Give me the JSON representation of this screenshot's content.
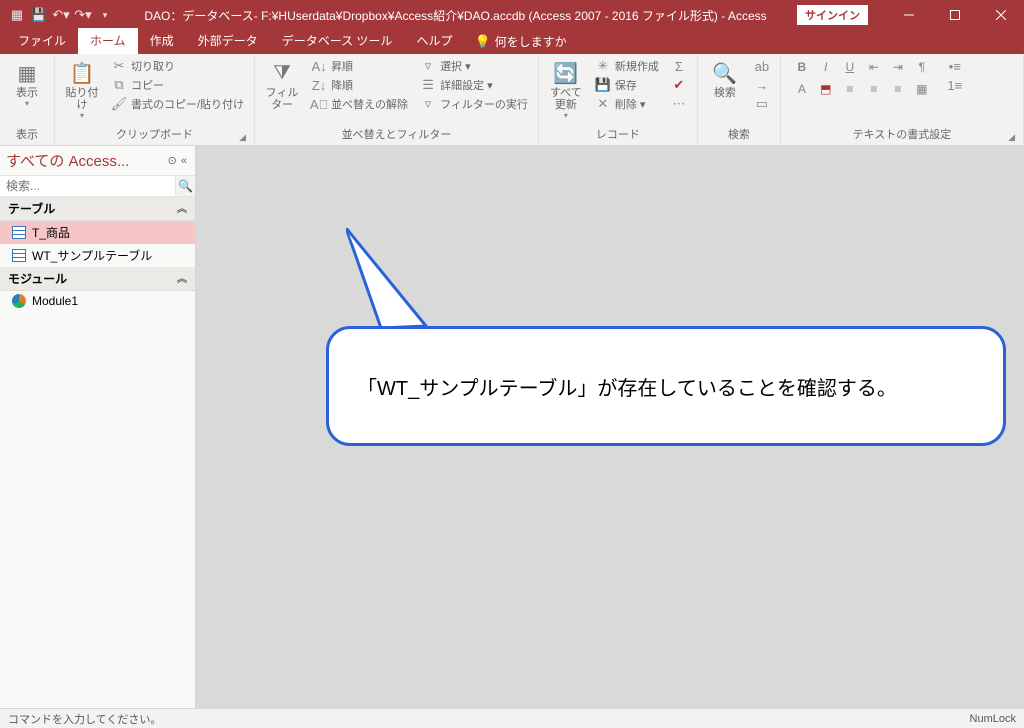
{
  "titlebar": {
    "title": "DAO：データベース- F:¥HUserdata¥Dropbox¥Access紹介¥DAO.accdb (Access 2007 - 2016 ファイル形式)  -  Access",
    "signin": "サインイン"
  },
  "tabs": {
    "file": "ファイル",
    "home": "ホーム",
    "create": "作成",
    "external": "外部データ",
    "dbtools": "データベース ツール",
    "help": "ヘルプ",
    "tell": "何をしますか"
  },
  "ribbon": {
    "view": {
      "label": "表示",
      "group": "表示"
    },
    "clipboard": {
      "paste": "貼り付け",
      "cut": "切り取り",
      "copy": "コピー",
      "formatpainter": "書式のコピー/貼り付け",
      "group": "クリップボード"
    },
    "sortfilter": {
      "filter": "フィルター",
      "asc": "昇順",
      "desc": "降順",
      "clear": "並べ替えの解除",
      "select": "選択 ▾",
      "advanced": "詳細設定 ▾",
      "run": "フィルターの実行",
      "group": "並べ替えとフィルター"
    },
    "records": {
      "refresh": "すべて更新",
      "new": "新規作成",
      "save": "保存",
      "delete": "削除 ▾",
      "group": "レコード"
    },
    "find": {
      "label": "検索",
      "group": "検索"
    },
    "textformat": {
      "group": "テキストの書式設定"
    }
  },
  "nav": {
    "title": "すべての Access...",
    "search_placeholder": "検索...",
    "groups": {
      "tables": "テーブル",
      "modules": "モジュール"
    },
    "items": {
      "t1": "T_商品",
      "t2": "WT_サンプルテーブル",
      "m1": "Module1"
    }
  },
  "callout": "「WT_サンプルテーブル」が存在していることを確認する。",
  "status": {
    "left": "コマンドを入力してください。",
    "right": "NumLock"
  }
}
